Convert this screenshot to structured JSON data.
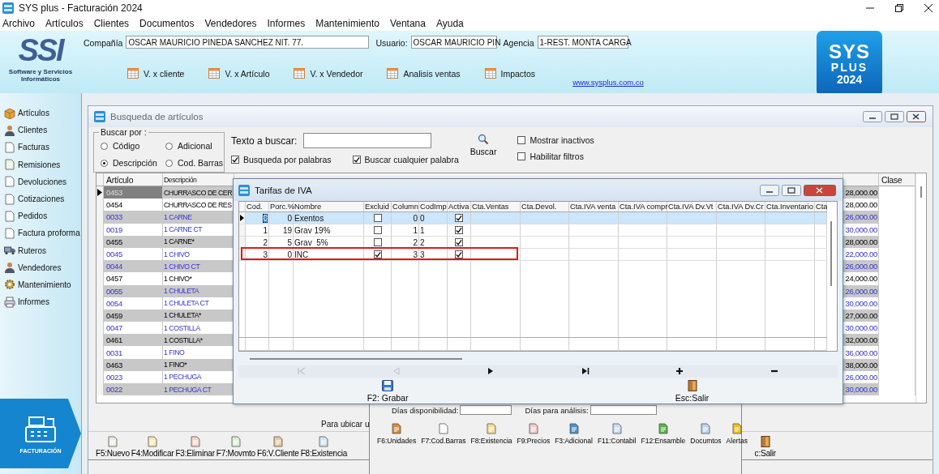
{
  "window": {
    "title": "SYS plus - Facturación 2024"
  },
  "menu": [
    "Archivo",
    "Artículos",
    "Clientes",
    "Documentos",
    "Vendedores",
    "Informes",
    "Mantenimiento",
    "Ventana",
    "Ayuda"
  ],
  "header": {
    "logo_text": "SSI",
    "logo_caption": "Software y Servicios Informáticos",
    "fields": [
      {
        "label": "Compañía",
        "value": "OSCAR MAURICIO PINEDA SANCHEZ NIT. 77."
      },
      {
        "label": "Usuario:",
        "value": "OSCAR MAURICIO PIN"
      },
      {
        "label": "Agencia",
        "value": "1-REST. MONTA CARGA"
      }
    ],
    "reports": [
      "V. x cliente",
      "V. x Artículo",
      "V. x Vendedor",
      "Analisis ventas",
      "Impactos"
    ],
    "link": "www.sysplus.com.co",
    "brand": [
      "SYS",
      "PLUS",
      "2024"
    ]
  },
  "sidebar": {
    "items": [
      "Artículos",
      "Clientes",
      "Facturas",
      "Remisiones",
      "Devoluciones",
      "Cotizaciones",
      "Pedidos",
      "Factura proforma",
      "Ruteros",
      "Vendedores",
      "Mantenimiento",
      "Informes"
    ],
    "module": "FACTURACIÓN"
  },
  "search_window": {
    "title": "Busqueda de artículos",
    "search_by": {
      "label": "Buscar por :",
      "options": [
        {
          "label": "Código",
          "selected": false
        },
        {
          "label": "Adicional",
          "selected": false
        },
        {
          "label": "Descripción",
          "selected": true
        },
        {
          "label": "Cod. Barras",
          "selected": false
        }
      ]
    },
    "search_text": {
      "label": "Texto a buscar:"
    },
    "search_button": "Buscar",
    "options": [
      {
        "label": "Busqueda por palabras",
        "checked": true
      },
      {
        "label": "Buscar cualquier palabra",
        "checked": true
      },
      {
        "label": "Mostrar inactivos",
        "checked": false
      },
      {
        "label": "Habilitar filtros",
        "checked": false
      }
    ],
    "table": {
      "columns": [
        "Artículo",
        "Descripción",
        "Clase"
      ],
      "rows": [
        {
          "code": "0453",
          "description": "CHURRASCO DE CER",
          "price": "28,000.00",
          "kind": "plain",
          "selected": true
        },
        {
          "code": "0454",
          "description": "CHURRASCO DE RES",
          "price": "28,000.00",
          "kind": "plain",
          "selected": false
        },
        {
          "code": "0033",
          "description": "1 CARNE",
          "price": "26,000.00",
          "kind": "linked",
          "selected": false
        },
        {
          "code": "0019",
          "description": "1 CARNE CT",
          "price": "30,000.00",
          "kind": "linked",
          "selected": false
        },
        {
          "code": "0455",
          "description": "1 CARNE*",
          "price": "28,000.00",
          "kind": "plain",
          "selected": false
        },
        {
          "code": "0045",
          "description": "1 CHIVO",
          "price": "22,000.00",
          "kind": "linked",
          "selected": false
        },
        {
          "code": "0044",
          "description": "1 CHIVO CT",
          "price": "26,000.00",
          "kind": "linked",
          "selected": false
        },
        {
          "code": "0457",
          "description": "1 CHIVO*",
          "price": "24,000.00",
          "kind": "plain",
          "selected": false
        },
        {
          "code": "0055",
          "description": "1 CHULETA",
          "price": "26,000.00",
          "kind": "linked",
          "selected": false
        },
        {
          "code": "0054",
          "description": "1 CHULETA CT",
          "price": "30,000.00",
          "kind": "linked",
          "selected": false
        },
        {
          "code": "0459",
          "description": "1 CHULETA*",
          "price": "27,000.00",
          "kind": "plain",
          "selected": false
        },
        {
          "code": "0047",
          "description": "1 COSTILLA",
          "price": "30,000.00",
          "kind": "linked",
          "selected": false
        },
        {
          "code": "0461",
          "description": "1 COSTILLA*",
          "price": "32,000.00",
          "kind": "plain",
          "selected": false
        },
        {
          "code": "0031",
          "description": "1 FINO",
          "price": "36,000.00",
          "kind": "linked",
          "selected": false
        },
        {
          "code": "0463",
          "description": "1 FINO*",
          "price": "38,000.00",
          "kind": "plain",
          "selected": false
        },
        {
          "code": "0023",
          "description": "1 PECHUGA",
          "price": "26,000.00",
          "kind": "linked",
          "selected": false
        },
        {
          "code": "0022",
          "description": "1 PECHUGA CT",
          "price": "30,000.00",
          "kind": "linked",
          "selected": false
        }
      ]
    },
    "footer_labels": [
      "Días disponibilidad:",
      "Días para análisis:"
    ],
    "locate_hint": "Para ubicar u",
    "toolbar": [
      "F5:Nuevo",
      "F4:Modificar",
      "F3:Eliminar",
      "F7:Movmto",
      "F6:V.Cliente",
      "F8:Existencia"
    ],
    "exit": "c:Salir"
  },
  "iva_dialog": {
    "title": "Tarifas de IVA",
    "columns": [
      "Cod.",
      "Porc.%",
      "Nombre",
      "Excluid",
      "Column",
      "CodImp",
      "Activa",
      "Cta.Ventas",
      "Cta.Devol.",
      "Cta.IVA venta",
      "Cta.IVA compr",
      "Cta.IVA Dv.Vt",
      "Cta.IVA Dv.Cr",
      "Cta.Inventario",
      "Cta"
    ],
    "rows": [
      {
        "cod": "0",
        "porc": "0",
        "nombre": "Exentos",
        "excluido": false,
        "columna": "0",
        "codimp": "0",
        "activa": true,
        "selected": true,
        "highlighted": false
      },
      {
        "cod": "1",
        "porc": "19",
        "nombre": "Grav 19%",
        "excluido": false,
        "columna": "1",
        "codimp": "1",
        "activa": true,
        "selected": false,
        "highlighted": false
      },
      {
        "cod": "2",
        "porc": "5",
        "nombre": "Grav  5%",
        "excluido": false,
        "columna": "2",
        "codimp": "2",
        "activa": true,
        "selected": false,
        "highlighted": false
      },
      {
        "cod": "3",
        "porc": "0",
        "nombre": "INC",
        "excluido": true,
        "columna": "3",
        "codimp": "3",
        "activa": true,
        "selected": false,
        "highlighted": true
      }
    ],
    "navigator": [
      {
        "kind": "first",
        "disabled": true
      },
      {
        "kind": "prev",
        "disabled": true
      },
      {
        "kind": "next",
        "disabled": false
      },
      {
        "kind": "last",
        "disabled": false
      },
      {
        "kind": "add",
        "disabled": false
      },
      {
        "kind": "remove",
        "disabled": false
      }
    ],
    "buttons": [
      "F2: Grabar",
      "Esc:Salir"
    ]
  },
  "tools_panel": {
    "buttons": [
      "F6:Unidades",
      "F7:Cod.Barras",
      "F8:Existencia",
      "F9:Precios",
      "F3:Adicional",
      "F11:Contabil",
      "F12:Ensamble",
      "Documtos",
      "Alertas"
    ]
  }
}
